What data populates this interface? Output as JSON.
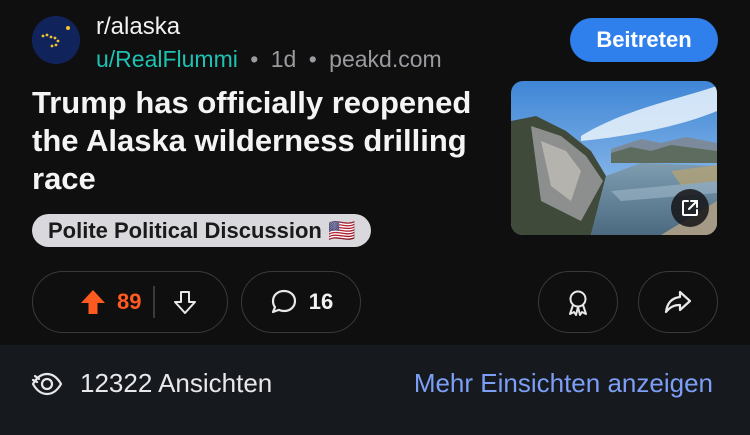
{
  "header": {
    "subreddit": "r/alaska",
    "user": "u/RealFlummi",
    "separator": "•",
    "age": "1d",
    "domain": "peakd.com",
    "join_label": "Beitreten"
  },
  "post": {
    "title": "Trump has officially reopened the Alaska wilderness drilling race",
    "flair": "Polite Political Discussion 🇺🇸"
  },
  "actions": {
    "upvotes": "89",
    "comments": "16"
  },
  "insights": {
    "views": "12322 Ansichten",
    "more_link": "Mehr Einsichten anzeigen"
  },
  "colors": {
    "accent_join": "#2f80ed",
    "user_link": "#1ec2b0",
    "upvote": "#ff5a1f",
    "insights_link": "#7c9ef5"
  },
  "icons": {
    "avatar": "alaska-flag-icon",
    "thumbnail_overlay": "external-link-icon",
    "upvote": "upvote-arrow-icon",
    "downvote": "downvote-arrow-icon",
    "comment": "comment-bubble-icon",
    "award": "award-ribbon-icon",
    "share": "share-arrow-icon",
    "views": "eye-icon"
  }
}
